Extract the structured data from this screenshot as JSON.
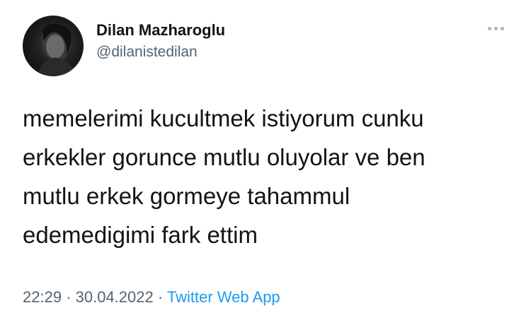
{
  "author": {
    "display_name": "Dilan Mazharoglu",
    "handle": "@dilanistedilan",
    "avatar_icon": "profile-photo"
  },
  "menu": {
    "icon": "more-options-icon"
  },
  "tweet": {
    "lines": [
      "memelerimi kucultmek istiyorum cunku",
      "erkekler gorunce mutlu oluyolar ve ben",
      "mutlu erkek gormeye tahammul",
      "edemedigimi fark ettim"
    ]
  },
  "meta": {
    "time": "22:29",
    "separator": " · ",
    "date": "30.04.2022",
    "source": "Twitter Web App"
  },
  "colors": {
    "text": "#0f1419",
    "secondary": "#536471",
    "link": "#1d9bf0"
  }
}
